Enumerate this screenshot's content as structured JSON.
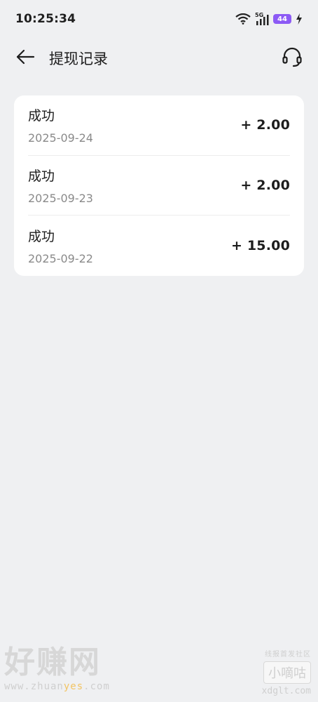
{
  "status_bar": {
    "time": "10:25:34",
    "network": "5G",
    "battery": "44"
  },
  "header": {
    "title": "提现记录"
  },
  "records": [
    {
      "status": "成功",
      "date": "2025-09-24",
      "amount": "+ 2.00"
    },
    {
      "status": "成功",
      "date": "2025-09-23",
      "amount": "+ 2.00"
    },
    {
      "status": "成功",
      "date": "2025-09-22",
      "amount": "+ 15.00"
    }
  ],
  "watermarks": {
    "left_title": "好赚网",
    "left_url_a": "www.zhuan",
    "left_url_b": "yes",
    "left_url_c": ".com",
    "right_small": "线报首发社区",
    "right_box": "小嘀咕",
    "right_url": "xdglt.com"
  },
  "icons": {
    "back": "arrow-left-icon",
    "support": "headset-icon",
    "wifi": "wifi-icon",
    "signal": "signal-icon",
    "charging": "charging-icon"
  },
  "colors": {
    "background": "#eff0f2",
    "card": "#ffffff",
    "battery": "#8c5af5"
  }
}
